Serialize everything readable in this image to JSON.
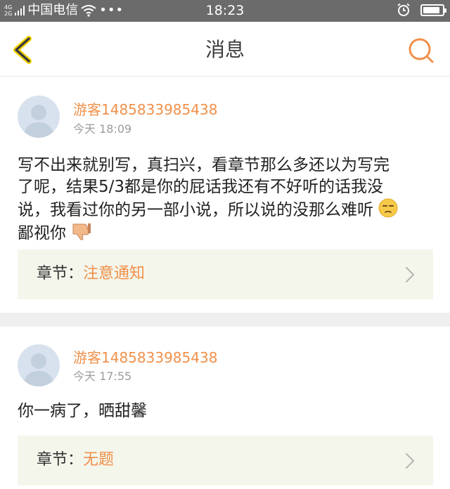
{
  "status_bar": {
    "network": "4G\n2G",
    "carrier": "中国电信",
    "more": "•••",
    "time": "18:23",
    "battery_level": 0.9
  },
  "nav": {
    "title": "消息",
    "accent_color": "#f0904a",
    "back_icon": "chevron-left-icon",
    "search_icon": "search-icon"
  },
  "messages": [
    {
      "user": "游客1485833985438",
      "time": "今天 18:09",
      "content_lines": [
        "写不出来就别写，真扫兴，看章节那么多还以为写完",
        "了呢，结果5/3都是你的屁话我还有不好听的话我没",
        "说，我看过你的另一部小说，所以说的没那么难听",
        "鄙视你"
      ],
      "chapter_label": "章节：",
      "chapter_value": "注意通知"
    },
    {
      "user": "游客1485833985438",
      "time": "今天 17:55",
      "content_lines": [
        "你一病了，晒甜馨"
      ],
      "chapter_label": "章节：",
      "chapter_value": "无题"
    }
  ]
}
